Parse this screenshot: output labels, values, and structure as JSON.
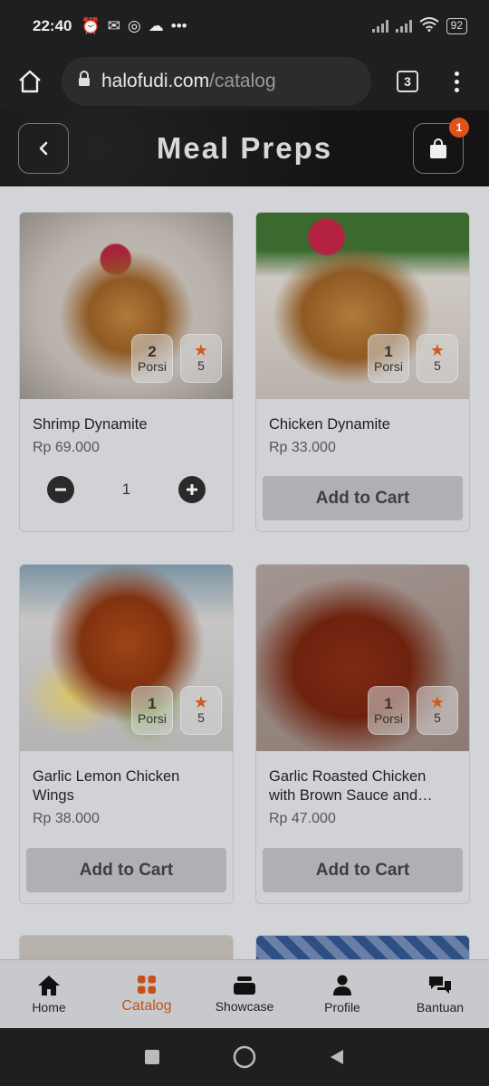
{
  "status_bar": {
    "time": "22:40",
    "battery": "92"
  },
  "browser": {
    "domain": "halofudi.com",
    "path": "/catalog",
    "tab_count": "3"
  },
  "header": {
    "title": "Meal Preps",
    "cart_count": "1"
  },
  "products": [
    {
      "name": "Shrimp Dynamite",
      "price": "Rp 69.000",
      "portion": "2",
      "portion_label": "Porsi",
      "rating": "5",
      "quantity": "1"
    },
    {
      "name": "Chicken Dynamite",
      "price": "Rp 33.000",
      "portion": "1",
      "portion_label": "Porsi",
      "rating": "5",
      "button": "Add to Cart"
    },
    {
      "name": "Garlic Lemon Chicken Wings",
      "price": "Rp 38.000",
      "portion": "1",
      "portion_label": "Porsi",
      "rating": "5",
      "button": "Add to Cart"
    },
    {
      "name": "Garlic Roasted Chicken with Brown Sauce and…",
      "price": "Rp 47.000",
      "portion": "1",
      "portion_label": "Porsi",
      "rating": "5",
      "button": "Add to Cart"
    }
  ],
  "bottom_nav": {
    "items": [
      {
        "label": "Home",
        "icon": "home-icon"
      },
      {
        "label": "Catalog",
        "icon": "grid-icon",
        "active": true
      },
      {
        "label": "Showcase",
        "icon": "showcase-icon"
      },
      {
        "label": "Profile",
        "icon": "person-icon"
      },
      {
        "label": "Bantuan",
        "icon": "chat-icon"
      }
    ]
  },
  "colors": {
    "accent": "#c84f18",
    "badge": "#e0521b",
    "header_bg": "#141414"
  }
}
